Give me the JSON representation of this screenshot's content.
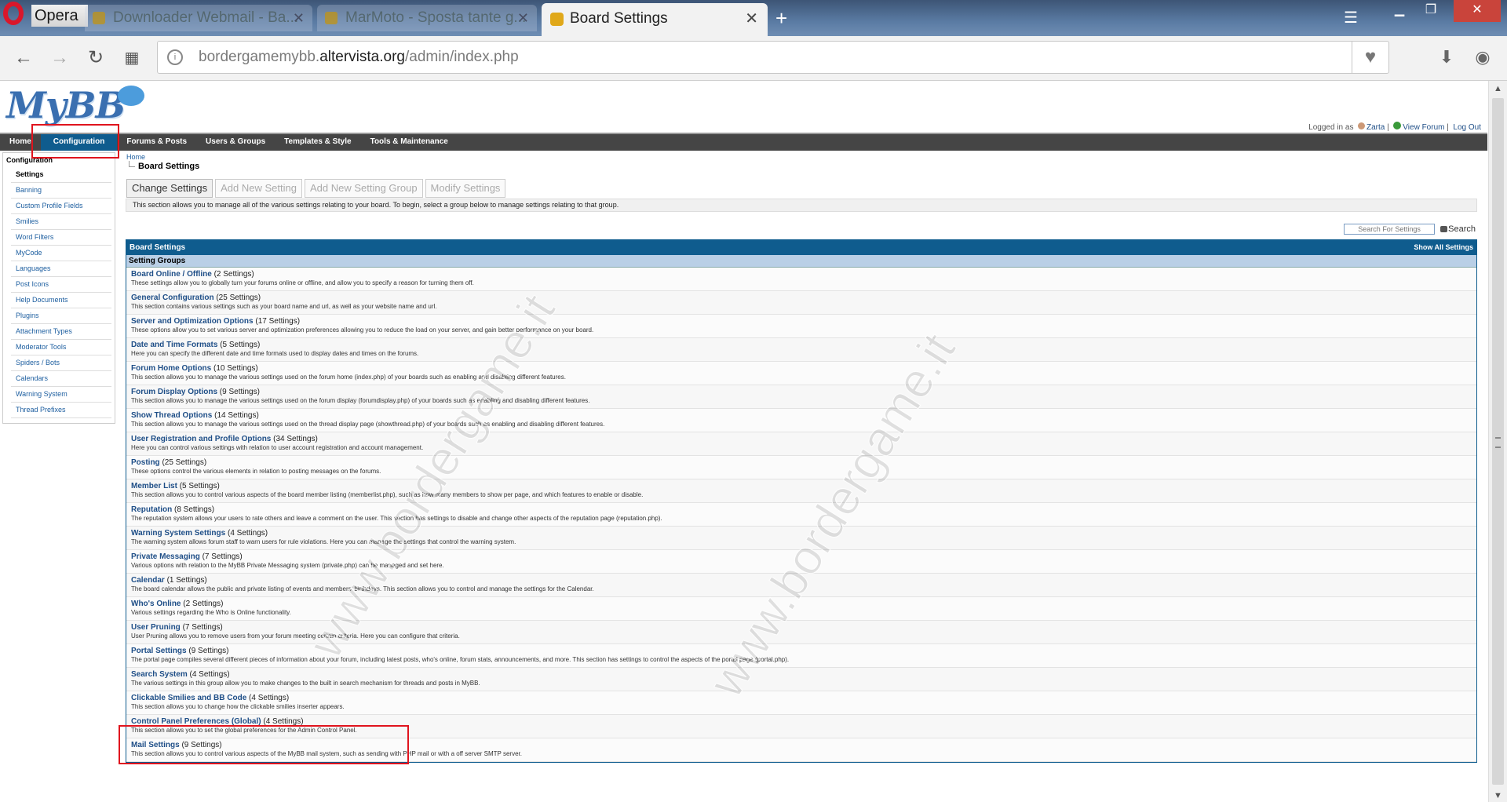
{
  "browser": {
    "app_name": "Opera",
    "tabs": [
      {
        "label": "Downloader Webmail - Ba..."
      },
      {
        "label": "MarMoto - Sposta tante g..."
      },
      {
        "label": "Board Settings",
        "active": true
      }
    ],
    "url_prefix": "bordergamemybb.",
    "url_domain": "altervista.org",
    "url_path": "/admin/index.php"
  },
  "header": {
    "logo": "MyBB",
    "logged_in_label": "Logged in as",
    "username": "Zarta",
    "view_forum": "View Forum",
    "log_out": "Log Out"
  },
  "menu": {
    "items": [
      {
        "label": "Home"
      },
      {
        "label": "Configuration"
      },
      {
        "label": "Forums & Posts"
      },
      {
        "label": "Users & Groups"
      },
      {
        "label": "Templates & Style"
      },
      {
        "label": "Tools & Maintenance"
      }
    ]
  },
  "sidebar": {
    "heading": "Configuration",
    "items": [
      {
        "label": "Settings"
      },
      {
        "label": "Banning"
      },
      {
        "label": "Custom Profile Fields"
      },
      {
        "label": "Smilies"
      },
      {
        "label": "Word Filters"
      },
      {
        "label": "MyCode"
      },
      {
        "label": "Languages"
      },
      {
        "label": "Post Icons"
      },
      {
        "label": "Help Documents"
      },
      {
        "label": "Plugins"
      },
      {
        "label": "Attachment Types"
      },
      {
        "label": "Moderator Tools"
      },
      {
        "label": "Spiders / Bots"
      },
      {
        "label": "Calendars"
      },
      {
        "label": "Warning System"
      },
      {
        "label": "Thread Prefixes"
      }
    ]
  },
  "content": {
    "breadcrumb_home": "Home",
    "page_title": "Board Settings",
    "subtabs": [
      {
        "label": "Change Settings"
      },
      {
        "label": "Add New Setting"
      },
      {
        "label": "Add New Setting Group"
      },
      {
        "label": "Modify Settings"
      }
    ],
    "description": "This section allows you to manage all of the various settings relating to your board. To begin, select a group below to manage settings relating to that group.",
    "search_placeholder": "Search For Settings",
    "search_button": "Search",
    "table_title": "Board Settings",
    "show_all": "Show All Settings",
    "section_label": "Setting Groups",
    "groups": [
      {
        "name": "Board Online / Offline",
        "count": "(2 Settings)",
        "desc": "These settings allow you to globally turn your forums online or offline, and allow you to specify a reason for turning them off."
      },
      {
        "name": "General Configuration",
        "count": "(25 Settings)",
        "desc": "This section contains various settings such as your board name and url, as well as your website name and url."
      },
      {
        "name": "Server and Optimization Options",
        "count": "(17 Settings)",
        "desc": "These options allow you to set various server and optimization preferences allowing you to reduce the load on your server, and gain better performance on your board."
      },
      {
        "name": "Date and Time Formats",
        "count": "(5 Settings)",
        "desc": "Here you can specify the different date and time formats used to display dates and times on the forums."
      },
      {
        "name": "Forum Home Options",
        "count": "(10 Settings)",
        "desc": "This section allows you to manage the various settings used on the forum home (index.php) of your boards such as enabling and disabling different features."
      },
      {
        "name": "Forum Display Options",
        "count": "(9 Settings)",
        "desc": "This section allows you to manage the various settings used on the forum display (forumdisplay.php) of your boards such as enabling and disabling different features."
      },
      {
        "name": "Show Thread Options",
        "count": "(14 Settings)",
        "desc": "This section allows you to manage the various settings used on the thread display page (showthread.php) of your boards such as enabling and disabling different features."
      },
      {
        "name": "User Registration and Profile Options",
        "count": "(34 Settings)",
        "desc": "Here you can control various settings with relation to user account registration and account management."
      },
      {
        "name": "Posting",
        "count": "(25 Settings)",
        "desc": "These options control the various elements in relation to posting messages on the forums."
      },
      {
        "name": "Member List",
        "count": "(5 Settings)",
        "desc": "This section allows you to control various aspects of the board member listing (memberlist.php), such as how many members to show per page, and which features to enable or disable."
      },
      {
        "name": "Reputation",
        "count": "(8 Settings)",
        "desc": "The reputation system allows your users to rate others and leave a comment on the user. This section has settings to disable and change other aspects of the reputation page (reputation.php)."
      },
      {
        "name": "Warning System Settings",
        "count": "(4 Settings)",
        "desc": "The warning system allows forum staff to warn users for rule violations. Here you can manage the settings that control the warning system."
      },
      {
        "name": "Private Messaging",
        "count": "(7 Settings)",
        "desc": "Various options with relation to the MyBB Private Messaging system (private.php) can be managed and set here."
      },
      {
        "name": "Calendar",
        "count": "(1 Settings)",
        "desc": "The board calendar allows the public and private listing of events and members' birthdays. This section allows you to control and manage the settings for the Calendar."
      },
      {
        "name": "Who's Online",
        "count": "(2 Settings)",
        "desc": "Various settings regarding the Who is Online functionality."
      },
      {
        "name": "User Pruning",
        "count": "(7 Settings)",
        "desc": "User Pruning allows you to remove users from your forum meeting certain criteria. Here you can configure that criteria."
      },
      {
        "name": "Portal Settings",
        "count": "(9 Settings)",
        "desc": "The portal page compiles several different pieces of information about your forum, including latest posts, who's online, forum stats, announcements, and more. This section has settings to control the aspects of the portal page (portal.php)."
      },
      {
        "name": "Search System",
        "count": "(4 Settings)",
        "desc": "The various settings in this group allow you to make changes to the built in search mechanism for threads and posts in MyBB."
      },
      {
        "name": "Clickable Smilies and BB Code",
        "count": "(4 Settings)",
        "desc": "This section allows you to change how the clickable smilies inserter appears."
      },
      {
        "name": "Control Panel Preferences (Global)",
        "count": "(4 Settings)",
        "desc": "This section allows you to set the global preferences for the Admin Control Panel."
      },
      {
        "name": "Mail Settings",
        "count": "(9 Settings)",
        "desc": "This section allows you to control various aspects of the MyBB mail system, such as sending with PHP mail or with a off server SMTP server."
      }
    ]
  },
  "watermark": "www.bordergame.it"
}
